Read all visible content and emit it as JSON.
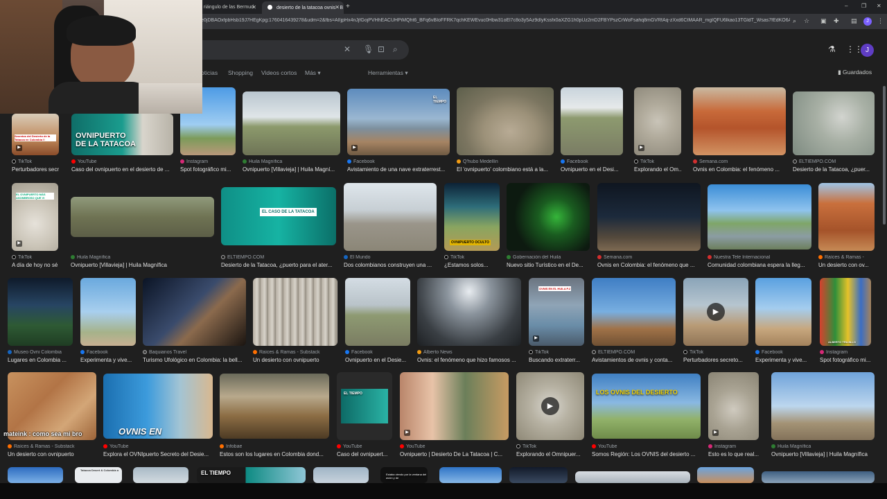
{
  "browser": {
    "tabs": [
      {
        "label": "riángulo de las Bermud"
      },
      {
        "label": "desierto de la tatacoa ovnis - B"
      }
    ],
    "url": "e0jDBAOxfpbHsb19J7HEgKpg:1760416439278&udm=2&fbs=AIIjpHx4nJjfGojPVHhEACUHPiMQht6_BFq6vBIoFFRK7qchKEWEvuc0Hbw31oEl7c8o3y5Az9dIyKssfx0aXZG1h0pUz2mD2FBYPszCrWoFsahq8mGVRfAq-zXxd6CtMAAR_mgIQFU6lkao13TGldT_Wsas7fEdKO6A0zPCNh5..."
  },
  "search": {
    "tabs": [
      "oticias",
      "Shopping",
      "Videos cortos",
      "Más ▾",
      "Herramientas ▾"
    ],
    "saved_label": "Guardados",
    "avatar_letter": "J"
  },
  "chat_overlay": "mateink : como sea mi bro",
  "rows": [
    {
      "items": [
        {
          "source": "TikTok",
          "caption": "Perturbadores secr...",
          "overlay": "Secretos del Desierto de la Tatacoa en Colombia !!"
        },
        {
          "source": "YouTube",
          "caption": "Caso del ovnipuerto en el desierto de ...",
          "overlay": "OVNIPUERTO DE LA TATACOA"
        },
        {
          "source": "Instagram",
          "caption": "Spot fotográfico mi...",
          "overlay": ""
        },
        {
          "source": "Huila Magnífica",
          "caption": "Ovnipuerto [Villavieja] | Huila Magní...",
          "overlay": ""
        },
        {
          "source": "Facebook",
          "caption": "Avistamiento de una nave extraterrest...",
          "overlay": "EL TIEMPO"
        },
        {
          "source": "Q'hubo Medellín",
          "caption": "El 'ovnipuerto' colombiano está a la...",
          "overlay": ""
        },
        {
          "source": "Facebook",
          "caption": "Ovnipuerto en el Desi...",
          "overlay": ""
        },
        {
          "source": "TikTok",
          "caption": "Explorando el Om...",
          "overlay": ""
        },
        {
          "source": "Semana.com",
          "caption": "Ovnis en Colombia: el fenómeno ...",
          "overlay": ""
        },
        {
          "source": "ELTIEMPO.COM",
          "caption": "Desierto de la Tatacoa, ¿puer...",
          "overlay": ""
        }
      ]
    },
    {
      "items": [
        {
          "source": "TikTok",
          "caption": "A día de hoy no sé...",
          "overlay": "EL OVNIPUERTO MÁS ASOMBROSO QUE VI"
        },
        {
          "source": "Huila Magnífica",
          "caption": "Ovnipuerto [Villavieja] | Huila Magnífica",
          "overlay": ""
        },
        {
          "source": "ELTIEMPO.COM",
          "caption": "Desierto de la Tatacoa, ¿puerto para el ater...",
          "overlay": "EL CASO DE LA TATACOA"
        },
        {
          "source": "El Mundo",
          "caption": "Dos colombianos construyen una ...",
          "overlay": ""
        },
        {
          "source": "TikTok",
          "caption": "¿Estamos solos...",
          "overlay": "OVNIPUERTO OCULTO"
        },
        {
          "source": "Gobernación del Huila",
          "caption": "Nuevo sitio Turístico en el De...",
          "overlay": ""
        },
        {
          "source": "Semana.com",
          "caption": "Ovnis en Colombia: el fenómeno que ...",
          "overlay": ""
        },
        {
          "source": "Nuestra Tele Internacional",
          "caption": "Comunidad colombiana espera la lleg...",
          "overlay": ""
        },
        {
          "source": "Raíces & Ramas -",
          "caption": "Un desierto con ov...",
          "overlay": ""
        }
      ]
    },
    {
      "items": [
        {
          "source": "Museo Ovni Colombia",
          "caption": "Lugares en Colombia ...",
          "overlay": ""
        },
        {
          "source": "Facebook",
          "caption": "Experimenta y vive...",
          "overlay": ""
        },
        {
          "source": "Baquianos Travel",
          "caption": "Turismo Ufológico en Colombia: la bell...",
          "overlay": ""
        },
        {
          "source": "Raíces & Ramas - Substack",
          "caption": "Un desierto con ovnipuerto",
          "overlay": ""
        },
        {
          "source": "Facebook",
          "caption": "Ovnipuerto en el Desie...",
          "overlay": ""
        },
        {
          "source": "Alberto News",
          "caption": "Ovnis: el fenómeno que hizo famosos ...",
          "overlay": ""
        },
        {
          "source": "TikTok",
          "caption": "Buscando extraterr...",
          "overlay": "OVNIS EN EL HUILA P.2"
        },
        {
          "source": "ELTIEMPO.COM",
          "caption": "Avistamientos de ovnis y conta...",
          "overlay": ""
        },
        {
          "source": "TikTok",
          "caption": "Perturbadores secreto...",
          "overlay": ""
        },
        {
          "source": "Facebook",
          "caption": "Experimenta y vive...",
          "overlay": ""
        },
        {
          "source": "Instagram",
          "caption": "Spot fotográfico mi...",
          "overlay": "ALBERTO TRUJILLO"
        }
      ]
    },
    {
      "items": [
        {
          "source": "Raíces & Ramas - Substack",
          "caption": "Un desierto con ovnipuerto",
          "overlay": ""
        },
        {
          "source": "YouTube",
          "caption": "Explora el OVNIpuerto Secreto del Desie...",
          "overlay": "OVNIS EN COLOMBIA"
        },
        {
          "source": "Infobae",
          "caption": "Estos son los lugares en Colombia dond...",
          "overlay": ""
        },
        {
          "source": "YouTube",
          "caption": "Caso del ovnipuert...",
          "overlay": "EL TIEMPO"
        },
        {
          "source": "YouTube",
          "caption": "Ovnipuerto | Desierto De La Tatacoa | C...",
          "overlay": ""
        },
        {
          "source": "TikTok",
          "caption": "Explorando el Omnipuer...",
          "overlay": ""
        },
        {
          "source": "YouTube",
          "caption": "Somos Región: Los OVNIS del desierto ...",
          "overlay": "LOS OVNIS DEL DESIERTO"
        },
        {
          "source": "Instagram",
          "caption": "Esto es lo que real...",
          "overlay": ""
        },
        {
          "source": "Huila Magnífica",
          "caption": "Ovnipuerto [Villavieja] | Huila Magnífica",
          "overlay": ""
        }
      ]
    },
    {
      "items": [
        {
          "overlay": "Tatacoa Desert & Colombia a"
        },
        {
          "overlay": "EL TIEMPO"
        },
        {
          "overlay": "Estaba viendo por la ventana del avión y de"
        }
      ]
    }
  ]
}
